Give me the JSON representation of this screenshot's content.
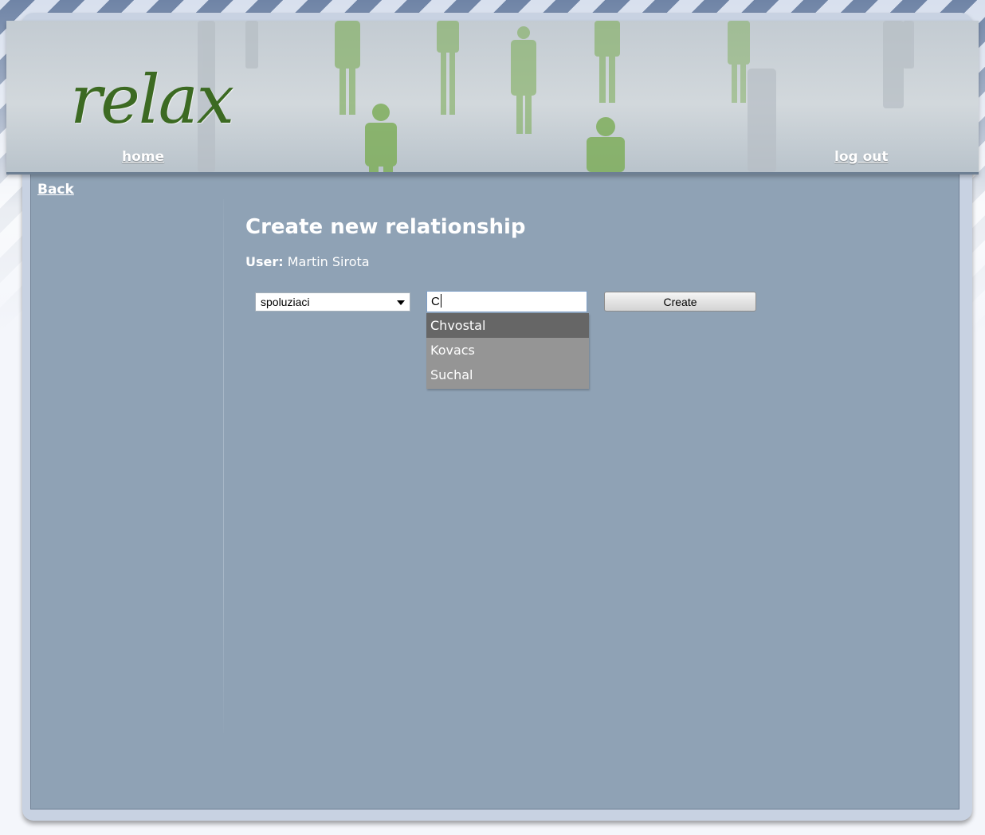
{
  "header": {
    "logo_text": "relax",
    "home_link": "home",
    "logout_link": "log out"
  },
  "nav": {
    "back_link": "Back"
  },
  "main": {
    "title": "Create new relationship",
    "user_label": "User:",
    "user_name": "Martin Sirota",
    "relationship_select": {
      "selected": "spoluziaci"
    },
    "name_input": {
      "value": "C"
    },
    "create_button": "Create",
    "suggestions": [
      "Chvostal",
      "Kovacs",
      "Suchal"
    ],
    "active_suggestion_index": 0
  },
  "colors": {
    "panel": "#8fa2b5",
    "logo": "#3c6a22",
    "suggestion_active": "#666666",
    "suggestion_bg": "#959595"
  }
}
